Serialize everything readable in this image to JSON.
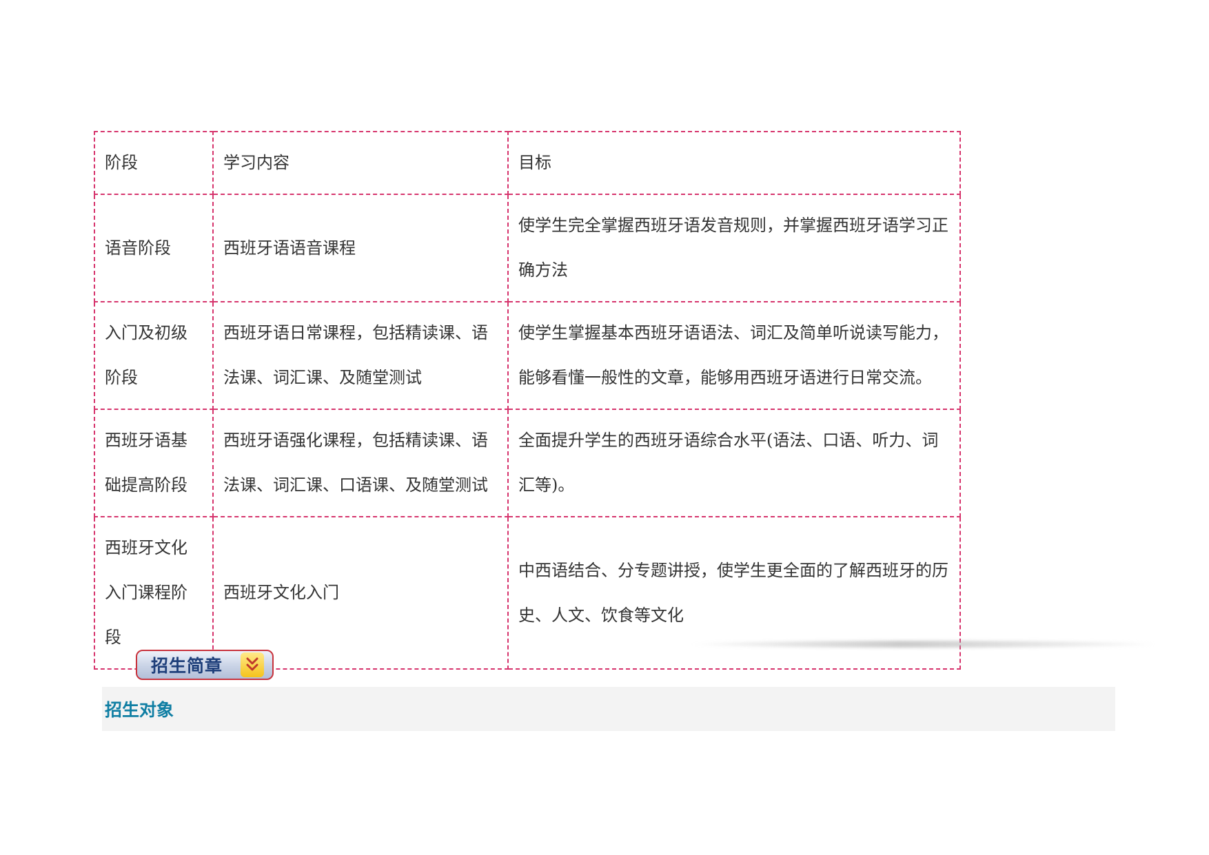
{
  "table": {
    "headers": [
      "阶段",
      "学习内容",
      "目标"
    ],
    "rows": [
      {
        "stage": "语音阶段",
        "content": "西班牙语语音课程",
        "goal": "使学生完全掌握西班牙语发音规则，并掌握西班牙语学习正确方法"
      },
      {
        "stage": "入门及初级阶段",
        "content": "西班牙语日常课程，包括精读课、语法课、词汇课、及随堂测试",
        "goal": "使学生掌握基本西班牙语语法、词汇及简单听说读写能力，能够看懂一般性的文章，能够用西班牙语进行日常交流。"
      },
      {
        "stage": "西班牙语基础提高阶段",
        "content": "西班牙语强化课程，包括精读课、语法课、词汇课、口语课、及随堂测试",
        "goal": "全面提升学生的西班牙语综合水平(语法、口语、听力、词汇等)。"
      },
      {
        "stage": "西班牙文化入门课程阶段",
        "content": "西班牙文化入门",
        "goal": "中西语结合、分专题讲授，使学生更全面的了解西班牙的历史、人文、饮食等文化"
      }
    ]
  },
  "brochure_button": {
    "label": "招生简章",
    "icon": "double-chevron-down-icon"
  },
  "section": {
    "title": "招生对象"
  },
  "colors": {
    "table_border": "#d6336c",
    "section_title": "#0f7ea3",
    "section_bg": "#f3f3f3",
    "button_border": "#c8323c",
    "button_text": "#1e3f7a",
    "icon_bg": "#f5c31c"
  }
}
